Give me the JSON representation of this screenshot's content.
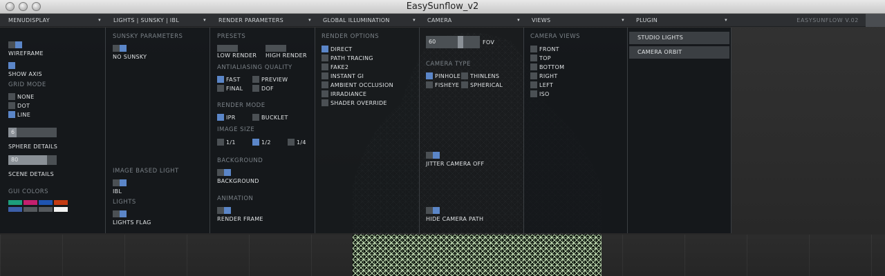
{
  "window": {
    "title": "EasySunflow_v2",
    "controls": [
      "close",
      "minimize",
      "zoom"
    ]
  },
  "menubar": {
    "menus": [
      "MENUDISPLAY",
      "LIGHTS | SUNSKY | IBL",
      "RENDER PARAMETERS",
      "GLOBAL ILLUMINATION",
      "CAMERA",
      "VIEWS",
      "PLUGIN"
    ],
    "arrow": "▾",
    "version": "EASYSUNFLOW V.02"
  },
  "display": {
    "wireframe": "WIREFRAME",
    "show_axis": "SHOW AXIS",
    "grid_mode_title": "GRID MODE",
    "grid_options": [
      "NONE",
      "DOT",
      "LINE"
    ],
    "sphere_value": "6",
    "sphere_label": "SPHERE DETAILS",
    "scene_value": "80",
    "scene_label": "SCENE DETAILS",
    "gui_colors_title": "GUI COLORS",
    "gui_colors": [
      "#1d9e7c",
      "#c41f6e",
      "#1f54b0",
      "#c23a12",
      "#3c5ea8",
      "#55595d",
      "#55595d",
      "#f2f2f2"
    ]
  },
  "lights": {
    "sunsky_title": "SUNSKY PARAMETERS",
    "no_sunsky": "NO SUNSKY",
    "ibl_title": "IMAGE BASED LIGHT",
    "ibl": "IBL",
    "lights_title": "LIGHTS",
    "lights_flag": "LIGHTS FLAG"
  },
  "render": {
    "presets_title": "PRESETS",
    "low_render": "LOW RENDER",
    "high_render": "HIGH RENDER",
    "aa_title": "ANTIALIASING QUALITY",
    "aa_options": [
      "FAST",
      "PREVIEW",
      "FINAL",
      "DOF"
    ],
    "mode_title": "RENDER MODE",
    "mode_options": [
      "IPR",
      "BUCKLET"
    ],
    "size_title": "IMAGE SIZE",
    "size_options": [
      "1/1",
      "1/2",
      "1/4"
    ],
    "background_title": "BACKGROUND",
    "background": "BACKGROUND",
    "animation_title": "ANIMATION",
    "render_frame": "RENDER FRAME"
  },
  "gi": {
    "title": "RENDER OPTIONS",
    "options": [
      "DIRECT",
      "PATH TRACING",
      "FAKE2",
      "INSTANT GI",
      "AMBIENT OCCLUSION",
      "IRRADIANCE",
      "SHADER OVERRIDE"
    ]
  },
  "camera": {
    "fov_value": "60",
    "fov_label": "FOV",
    "type_title": "CAMERA TYPE",
    "types": [
      "PINHOLE",
      "THINLENS",
      "FISHEYE",
      "SPHERICAL"
    ],
    "jitter": "JITTER CAMERA OFF",
    "hide_path": "HIDE CAMERA PATH"
  },
  "views": {
    "title": "CAMERA VIEWS",
    "items": [
      "FRONT",
      "TOP",
      "BOTTOM",
      "RIGHT",
      "LEFT",
      "ISO"
    ]
  },
  "plugin": {
    "items": [
      "STUDIO LIGHTS",
      "CAMERA ORBIT"
    ]
  }
}
